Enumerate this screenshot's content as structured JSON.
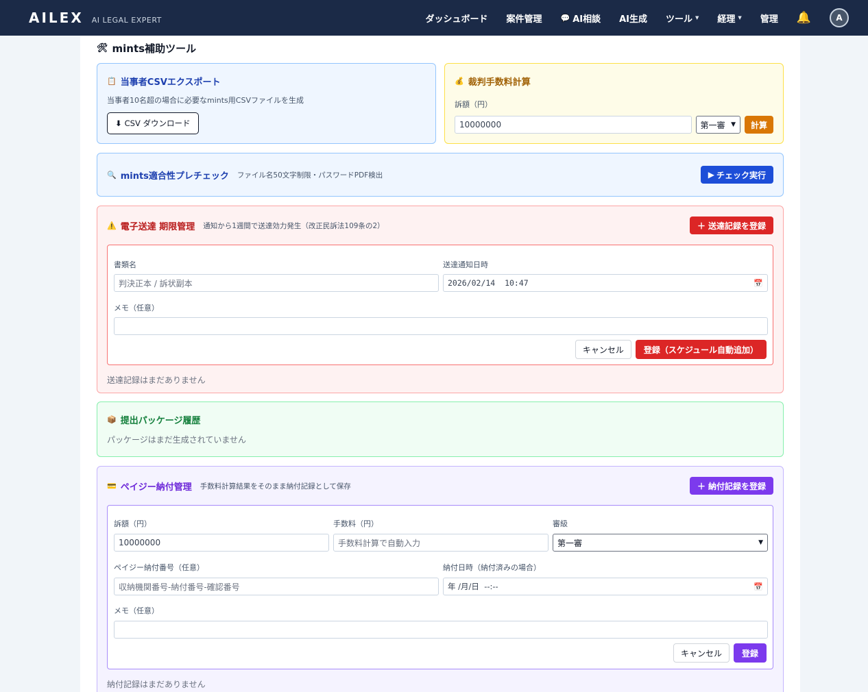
{
  "nav": {
    "brand": "AILEX",
    "brand_sub": "AI LEGAL EXPERT",
    "items": [
      {
        "label": "ダッシュボード"
      },
      {
        "label": "案件管理"
      },
      {
        "label": "AI相談",
        "icon": "chat-bubble-icon"
      },
      {
        "label": "AI生成"
      },
      {
        "label": "ツール",
        "dropdown": true
      },
      {
        "label": "経理",
        "dropdown": true
      },
      {
        "label": "管理"
      }
    ],
    "bell_icon": "bell-icon",
    "avatar": "A"
  },
  "page": {
    "title": "mints補助ツール",
    "title_icon": "tools-icon"
  },
  "csv": {
    "title": "当事者CSVエクスポート",
    "icon": "clipboard-icon",
    "desc": "当事者10名超の場合に必要なmints用CSVファイルを生成",
    "button": "CSV ダウンロード",
    "button_icon": "download-arrow-icon"
  },
  "fee": {
    "title": "裁判手数料計算",
    "icon": "money-bag-icon",
    "label": "訴額（円）",
    "amount": "10000000",
    "instance": "第一審",
    "button": "計算"
  },
  "precheck": {
    "title": "mints適合性プレチェック",
    "icon": "magnifier-icon",
    "desc": "ファイル名50文字制限・パスワードPDF検出",
    "button": "チェック実行",
    "button_icon": "play-icon"
  },
  "service": {
    "title": "電子送達 期限管理",
    "icon": "warning-icon",
    "desc": "通知から1週間で送達効力発生（改正民訴法109条の2）",
    "add_button": "送達記録を登録",
    "doc_label": "書類名",
    "doc_placeholder": "判決正本 / 訴状副本",
    "date_label": "送達通知日時",
    "date_value": "2026/02/14  10:47",
    "memo_label": "メモ（任意）",
    "memo_value": "",
    "cancel": "キャンセル",
    "submit": "登録（スケジュール自動追加）",
    "empty": "送達記録はまだありません"
  },
  "packages": {
    "title": "提出パッケージ履歴",
    "icon": "package-icon",
    "empty": "パッケージはまだ生成されていません"
  },
  "payeasy": {
    "title": "ペイジー納付管理",
    "icon": "credit-card-icon",
    "desc": "手数料計算結果をそのまま納付記録として保存",
    "add_button": "納付記録を登録",
    "amount_label": "訴額（円）",
    "amount_value": "10000000",
    "fee_label": "手数料（円）",
    "fee_placeholder": "手数料計算で自動入力",
    "instance_label": "審級",
    "instance_value": "第一審",
    "number_label": "ペイジー納付番号（任意）",
    "number_placeholder": "収納機関番号-納付番号-確認番号",
    "paid_label": "納付日時（納付済みの場合）",
    "paid_placeholder": "年 /月/日  --:--",
    "memo_label": "メモ（任意）",
    "memo_value": "",
    "cancel": "キャンセル",
    "submit": "登録",
    "empty": "納付記録はまだありません"
  }
}
